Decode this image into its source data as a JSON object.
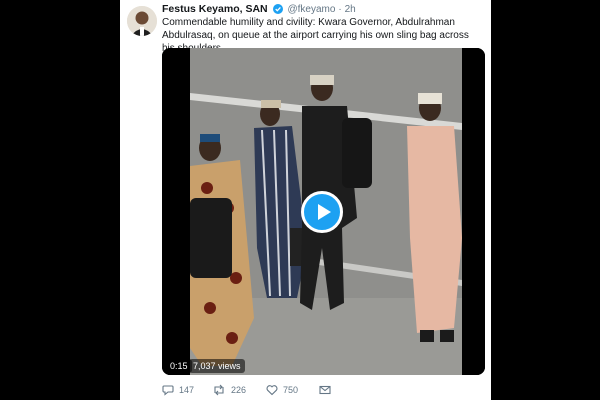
{
  "tweet": {
    "author_name": "Festus Keyamo, SAN",
    "handle": "@fkeyamo",
    "separator": "·",
    "time": "2h",
    "text": "Commendable humility and civility: Kwara Governor, Abdulrahman Abdulrasaq, on queue at the airport carrying his own sling bag across his shoulders"
  },
  "video": {
    "duration": "0:15",
    "views": "7,037 views"
  },
  "actions": {
    "replies": "147",
    "retweets": "226",
    "likes": "750"
  },
  "colors": {
    "brand": "#1da1f2",
    "text": "#14171a",
    "muted": "#657786"
  }
}
